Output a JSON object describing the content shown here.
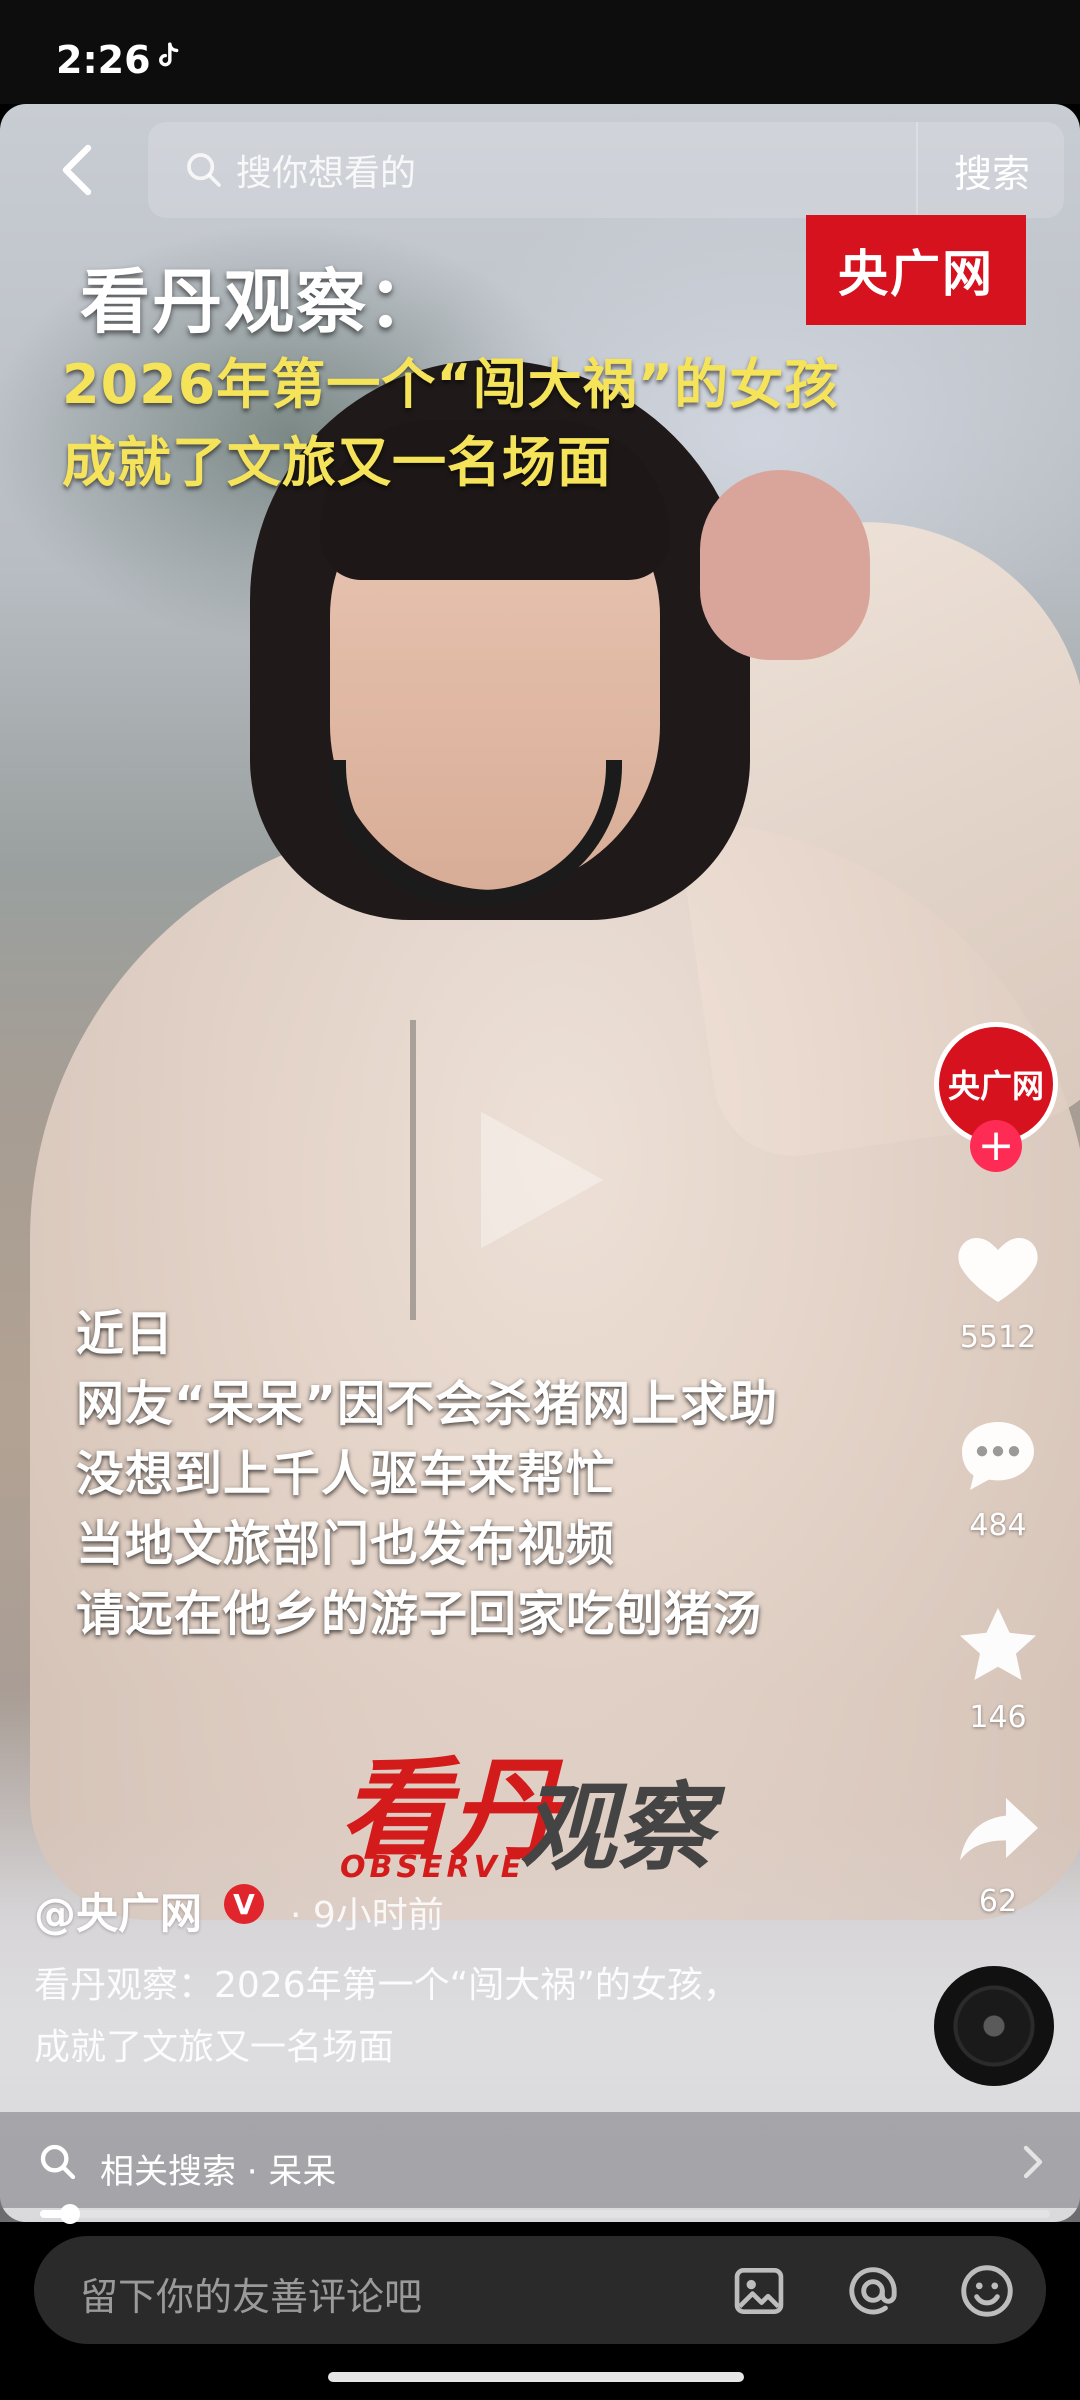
{
  "status_bar": {
    "time": "2:26"
  },
  "search": {
    "placeholder": "搜你想看的",
    "button": "搜索"
  },
  "overlay": {
    "title_main": "看丹观察：",
    "title_lines": [
      "2026年第一个“闯大祸”的女孩",
      "成就了文旅又一名场面"
    ],
    "source_logo": "央广网"
  },
  "subtitles": [
    "近日",
    "网友“呆呆”因不会杀猪网上求助",
    "没想到上千人驱车来帮忙",
    "当地文旅部门也发布视频",
    "请远在他乡的游子回家吃刨猪汤"
  ],
  "observe_logo": {
    "left": "看丹",
    "en": "OBSERVE",
    "right": "观察"
  },
  "post": {
    "author": "@央广网",
    "verified_badge": "V",
    "time_ago": "· 9小时前",
    "desc_lines": [
      "看丹观察：2026年第一个“闯大祸”的女孩，",
      "成就了文旅又一名场面"
    ]
  },
  "rail": {
    "avatar_text": "央广网",
    "follow_symbol": "+",
    "likes": "5512",
    "comments": "484",
    "favorites": "146",
    "shares": "62"
  },
  "related": {
    "label": "相关搜索 · 呆呆"
  },
  "progress": {
    "fraction": 0.03
  },
  "comment": {
    "placeholder": "留下你的友善评论吧"
  },
  "colors": {
    "accent": "#fe2c55",
    "brand_red": "#d5121d",
    "subtitle_yellow": "#f5e35a"
  }
}
